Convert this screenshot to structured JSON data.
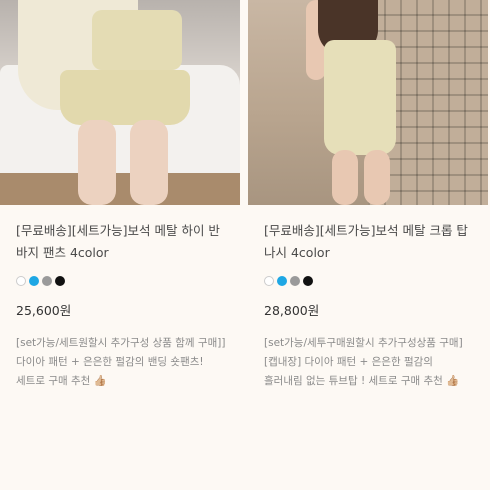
{
  "products": [
    {
      "title": "[무료배송][세트가능]보석 메탈 하이 반바지 팬츠 4color",
      "swatches": [
        "#ffffff",
        "#1ea7e4",
        "#9a9a9a",
        "#111111"
      ],
      "price": "25,600원",
      "description": "[set가능/세트원할시 추가구성 상품 함께 구매]] 다이아 패턴 + 은은한 펄감의 밴딩 숏팬츠! 세트로 구매 추천 👍🏼"
    },
    {
      "title": "[무료배송][세트가능]보석 메탈 크롭 탑나시 4color",
      "swatches": [
        "#ffffff",
        "#1ea7e4",
        "#9a9a9a",
        "#111111"
      ],
      "price": "28,800원",
      "description": "[set가능/세투구매원할시 추가구성상품 구매][캡내장] 다이아 패턴 + 은은한 펄감의 흘러내림 없는 튜브탑 ! 세트로 구매 추천 👍🏼"
    }
  ]
}
